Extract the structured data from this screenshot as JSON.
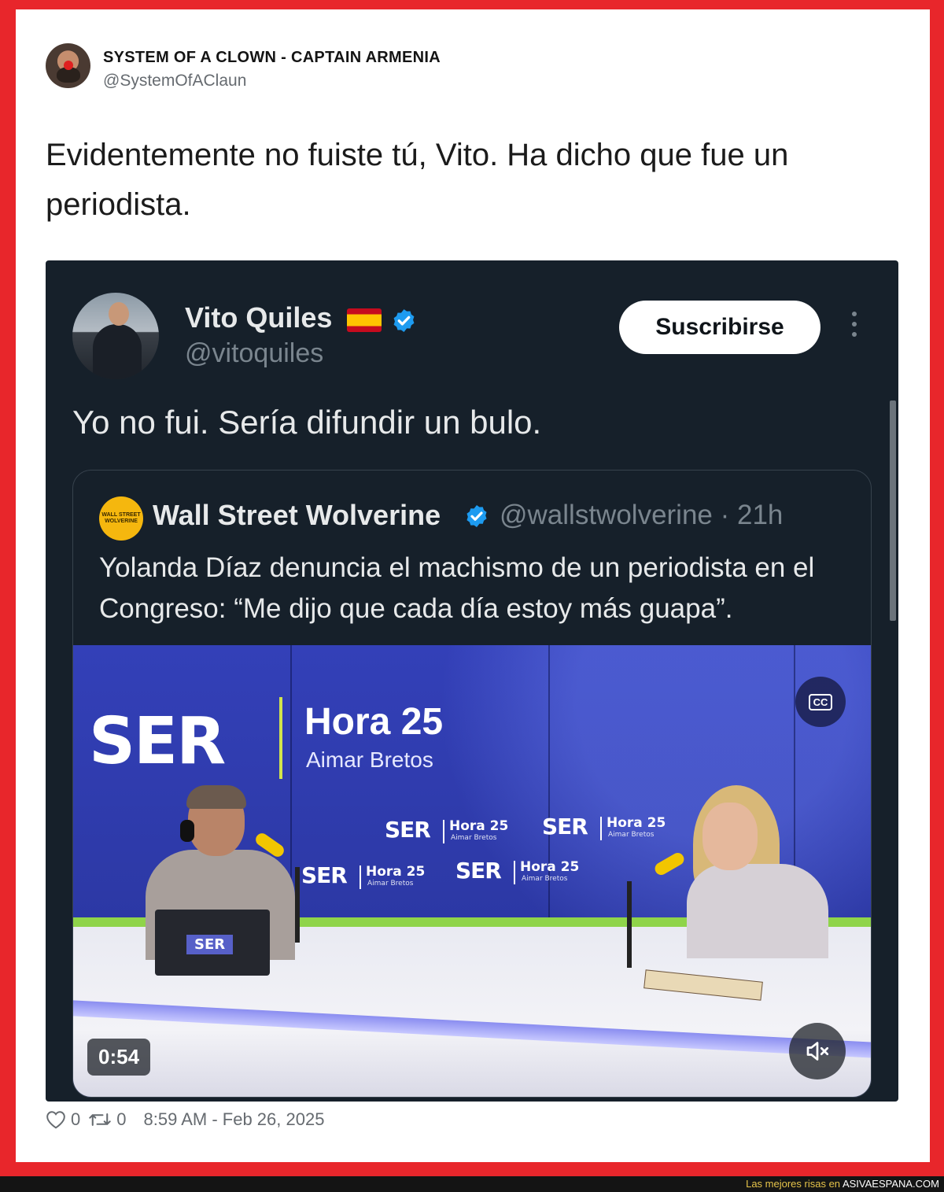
{
  "outer": {
    "display_name": "SYSTEM OF A CLOWN - CAPTAIN ARMENIA",
    "handle": "@SystemOfAClaun",
    "text": "Evidentemente no fuiste tú, Vito. Ha dicho que fue un periodista.",
    "likes": "0",
    "retweets": "0",
    "timestamp": "8:59 AM - Feb 26, 2025"
  },
  "embedded": {
    "display_name": "Vito Quiles",
    "handle": "@vitoquiles",
    "subscribe_label": "Suscribirse",
    "text": "Yo no fui. Sería difundir un bulo.",
    "quote": {
      "avatar_text_top": "WALL STREET",
      "avatar_text_bottom": "WOLVERINE",
      "display_name": "Wall Street Wolverine",
      "handle_time": "@wallstwolverine · 21h",
      "text": "Yolanda Díaz denuncia el machismo de un periodista en el Congreso: “Me dijo que cada día estoy más guapa”.",
      "video": {
        "brand": "SER",
        "show": "Hora 25",
        "host": "Aimar Bretos",
        "duration": "0:54",
        "cc_label": "CC"
      }
    }
  },
  "colors": {
    "frame": "#e8262b",
    "embed_bg": "#16202a",
    "verified": "#1d9bf0",
    "studio_blue": "#2c38a4"
  },
  "icons": [
    "heart-icon",
    "retweet-icon",
    "verified-badge-icon",
    "spain-flag-icon",
    "more-options-icon",
    "closed-captions-icon",
    "mute-icon"
  ],
  "watermark": {
    "prefix": "Las mejores risas en ",
    "site": "ASIVAESPANA.COM"
  }
}
